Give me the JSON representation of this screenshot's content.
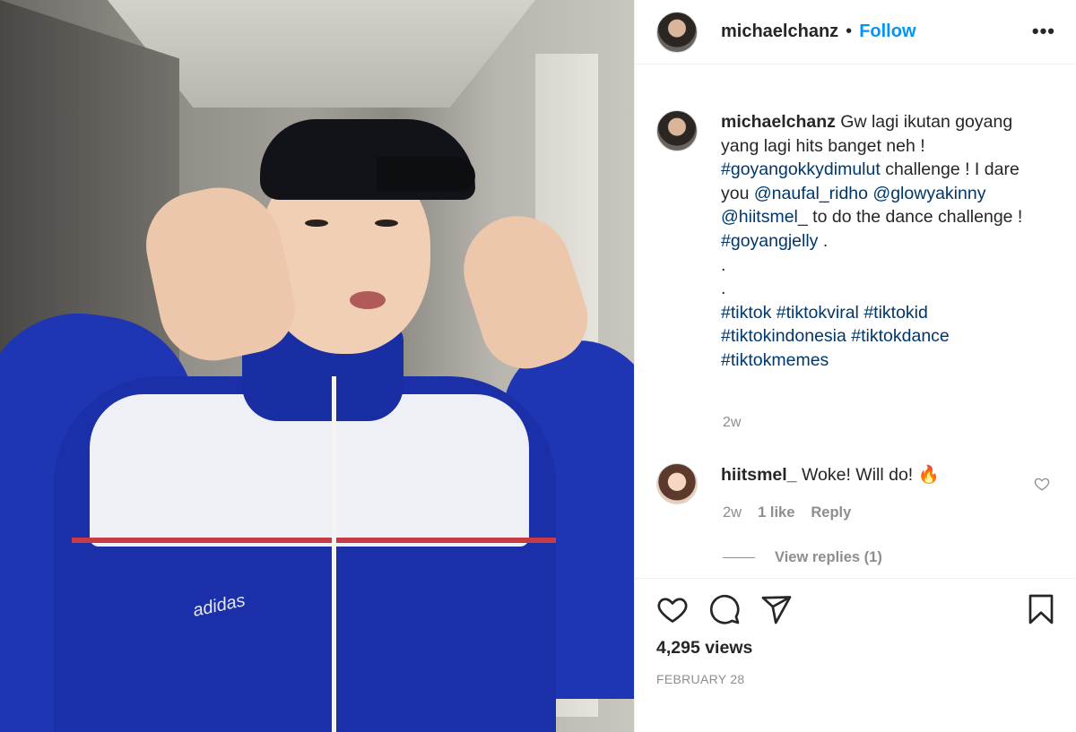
{
  "post": {
    "username": "michaelchanz",
    "separator": "•",
    "follow_label": "Follow",
    "more_label": "•••"
  },
  "caption": {
    "username": "michaelchanz",
    "text_1": " Gw lagi ikutan goyang yang lagi hits banget neh ! ",
    "tag_1": "#goyangokkydimulut",
    "text_2": " challenge ! I dare you ",
    "mention_1": "@naufal_ridho",
    "mention_2": "@glowyakinny",
    "mention_3": "@hiitsmel_",
    "text_3": " to do the dance challenge ! ",
    "tag_2": "#goyangjelly",
    "text_4": " .",
    "dot_1": ".",
    "dot_2": ".",
    "tags_tail": [
      "#tiktok",
      "#tiktokviral",
      "#tiktokid",
      "#tiktokindonesia",
      "#tiktokdance",
      "#tiktokmemes"
    ],
    "time": "2w"
  },
  "comment": {
    "username": "hiitsmel_",
    "text": " Woke! Will do! 🔥",
    "time": "2w",
    "likes": "1 like",
    "reply_label": "Reply",
    "view_replies": "View replies (1)"
  },
  "footer": {
    "views": "4,295 views",
    "date": "FEBRUARY 28"
  },
  "media": {
    "jacket_logo": "adidas"
  },
  "icons": [
    "heart-icon",
    "comment-icon",
    "share-icon",
    "bookmark-icon",
    "more-icon"
  ],
  "colors": {
    "link": "#0095f6",
    "hashtag": "#00376b",
    "muted": "#8e8e8e",
    "text": "#262626"
  }
}
